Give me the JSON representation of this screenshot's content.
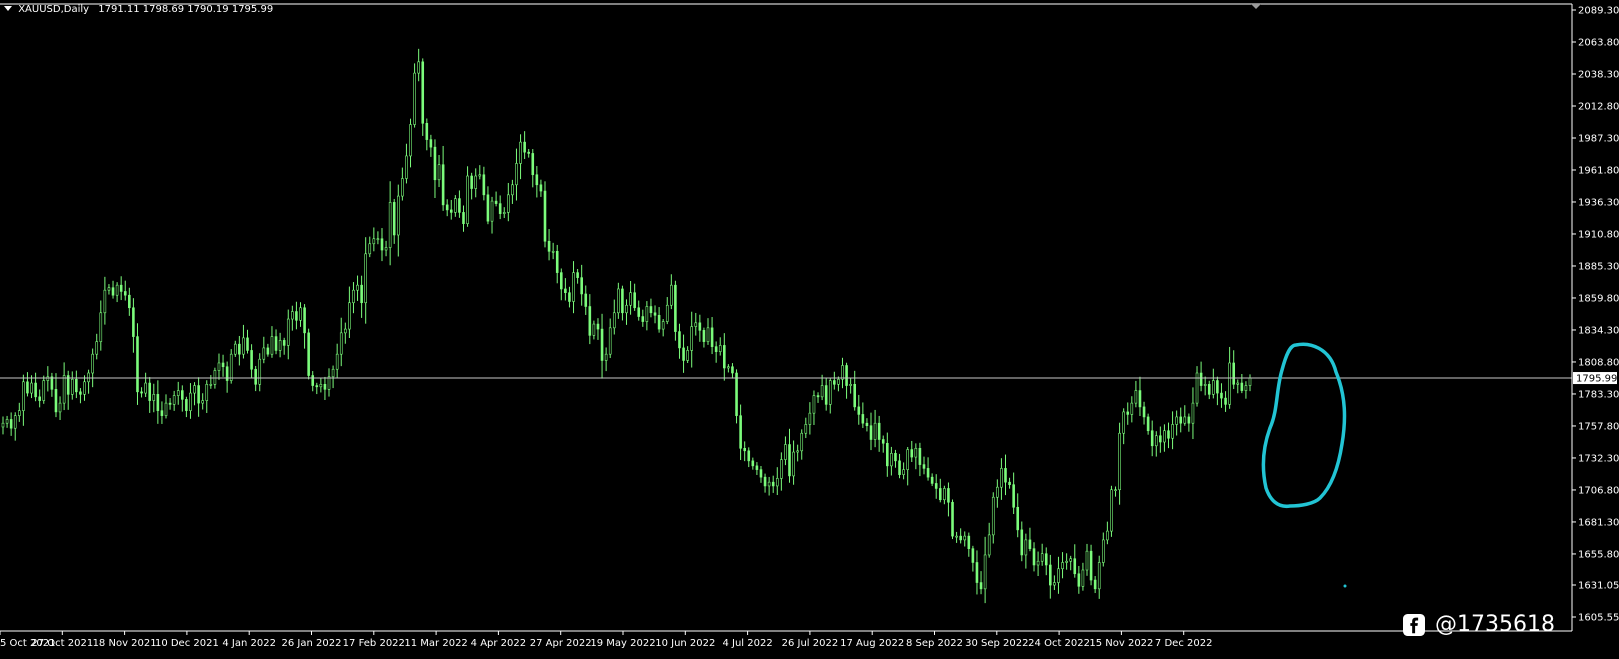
{
  "header": {
    "symbol": "XAUUSD,Daily",
    "ohlc": "1791.11 1798.69 1790.19 1795.99"
  },
  "watermark": {
    "text": "@1735618",
    "icon": "facebook-icon"
  },
  "colors": {
    "background": "#000000",
    "candle": "#7CFC7C",
    "axis": "#ffffff",
    "price_line": "#c8c8c8",
    "annotation": "#22c4d4"
  },
  "chart_data": {
    "type": "candlestick",
    "current_price": 1795.99,
    "current_price_label": "1795.99",
    "y_ticks": [
      "2089.30",
      "2063.80",
      "2038.30",
      "2012.80",
      "1987.30",
      "1961.80",
      "1936.30",
      "1910.80",
      "1885.30",
      "1859.80",
      "1834.30",
      "1808.80",
      "1783.30",
      "1757.80",
      "1732.30",
      "1706.80",
      "1681.30",
      "1655.80",
      "1631.05",
      "1605.55"
    ],
    "ylim": [
      1605.55,
      2089.3
    ],
    "x_labels": [
      "5 Oct 2021",
      "27 Oct 2021",
      "18 Nov 2021",
      "10 Dec 2021",
      "4 Jan 2022",
      "26 Jan 2022",
      "17 Feb 2022",
      "11 Mar 2022",
      "4 Apr 2022",
      "27 Apr 2022",
      "19 May 2022",
      "10 Jun 2022",
      "4 Jul 2022",
      "26 Jul 2022",
      "17 Aug 2022",
      "8 Sep 2022",
      "30 Sep 2022",
      "24 Oct 2022",
      "15 Nov 2022",
      "7 Dec 2022"
    ],
    "closes": [
      1760,
      1763,
      1756,
      1766,
      1770,
      1793,
      1784,
      1792,
      1781,
      1778,
      1794,
      1797,
      1787,
      1769,
      1776,
      1798,
      1783,
      1795,
      1785,
      1783,
      1793,
      1800,
      1815,
      1825,
      1848,
      1866,
      1868,
      1862,
      1870,
      1865,
      1862,
      1852,
      1829,
      1785,
      1784,
      1792,
      1778,
      1783,
      1770,
      1766,
      1776,
      1775,
      1782,
      1786,
      1779,
      1770,
      1784,
      1790,
      1776,
      1778,
      1791,
      1791,
      1802,
      1808,
      1805,
      1794,
      1815,
      1823,
      1815,
      1828,
      1818,
      1803,
      1791,
      1811,
      1820,
      1815,
      1829,
      1818,
      1826,
      1822,
      1843,
      1849,
      1842,
      1852,
      1832,
      1798,
      1790,
      1789,
      1791,
      1787,
      1797,
      1803,
      1815,
      1832,
      1835,
      1856,
      1866,
      1870,
      1856,
      1895,
      1903,
      1907,
      1907,
      1898,
      1900,
      1936,
      1910,
      1941,
      1955,
      1973,
      1998,
      2039,
      2048,
      1999,
      1986,
      1980,
      1954,
      1966,
      1934,
      1930,
      1928,
      1939,
      1928,
      1919,
      1957,
      1947,
      1957,
      1958,
      1942,
      1921,
      1937,
      1935,
      1927,
      1928,
      1942,
      1950,
      1967,
      1984,
      1976,
      1975,
      1958,
      1950,
      1945,
      1905,
      1897,
      1897,
      1880,
      1867,
      1864,
      1857,
      1880,
      1876,
      1863,
      1853,
      1830,
      1839,
      1835,
      1810,
      1815,
      1836,
      1848,
      1867,
      1848,
      1854,
      1864,
      1852,
      1845,
      1841,
      1853,
      1848,
      1846,
      1835,
      1841,
      1854,
      1870,
      1833,
      1820,
      1810,
      1818,
      1837,
      1840,
      1834,
      1825,
      1836,
      1821,
      1817,
      1822,
      1804,
      1805,
      1800,
      1766,
      1740,
      1738,
      1730,
      1726,
      1723,
      1717,
      1710,
      1713,
      1710,
      1716,
      1731,
      1743,
      1718,
      1737,
      1738,
      1752,
      1759,
      1768,
      1782,
      1781,
      1790,
      1775,
      1794,
      1791,
      1795,
      1806,
      1790,
      1791,
      1773,
      1767,
      1760,
      1758,
      1747,
      1760,
      1747,
      1744,
      1726,
      1736,
      1730,
      1719,
      1723,
      1739,
      1733,
      1740,
      1727,
      1724,
      1717,
      1712,
      1708,
      1699,
      1708,
      1697,
      1670,
      1670,
      1667,
      1670,
      1660,
      1649,
      1633,
      1628,
      1655,
      1671,
      1701,
      1709,
      1724,
      1713,
      1711,
      1693,
      1675,
      1655,
      1667,
      1660,
      1647,
      1650,
      1656,
      1647,
      1631,
      1633,
      1644,
      1649,
      1650,
      1652,
      1640,
      1630,
      1643,
      1658,
      1635,
      1628,
      1649,
      1667,
      1674,
      1707,
      1707,
      1752,
      1769,
      1767,
      1776,
      1786,
      1773,
      1765,
      1754,
      1742,
      1750,
      1745,
      1754,
      1748,
      1759,
      1765,
      1760,
      1765,
      1760,
      1776,
      1800,
      1790,
      1791,
      1783,
      1794,
      1784,
      1780,
      1775,
      1808,
      1791,
      1792,
      1786,
      1790,
      1796
    ]
  },
  "annotation": {
    "shape": "hand-drawn-ellipse"
  }
}
